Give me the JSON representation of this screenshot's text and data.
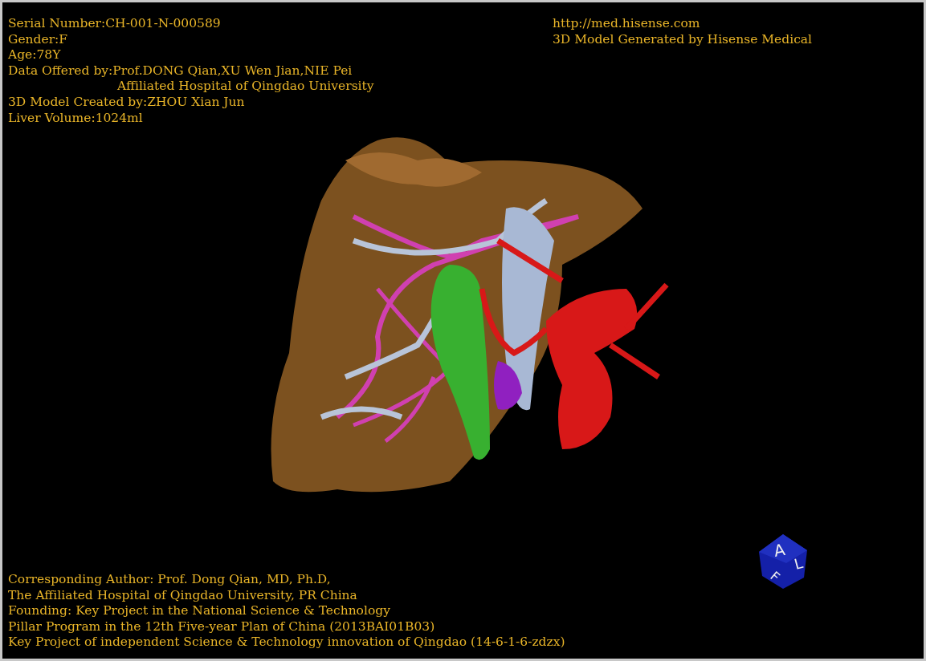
{
  "header_left": [
    "Serial Number:CH-001-N-000589",
    "Gender:F",
    "Age:78Y",
    "Data Offered by:Prof.DONG Qian,XU Wen Jian,NIE Pei",
    "Affiliated Hospital of Qingdao University",
    "3D Model Created by:ZHOU Xian Jun",
    "Liver Volume:1024ml"
  ],
  "header_right": [
    "http://med.hisense.com",
    "3D Model Generated by Hisense Medical"
  ],
  "footer": [
    "Corresponding Author: Prof. Dong Qian, MD, Ph.D,",
    "The Affiliated Hospital of Qingdao University, PR China",
    "Founding: Key Project in the National Science & Technology",
    "Pillar Program in the 12th Five-year Plan of China (2013BAI01B03)",
    "Key Project of independent Science & Technology innovation of Qingdao (14-6-1-6-zdzx)"
  ],
  "orientation_cube": {
    "faces": [
      "A",
      "L",
      "F"
    ]
  }
}
